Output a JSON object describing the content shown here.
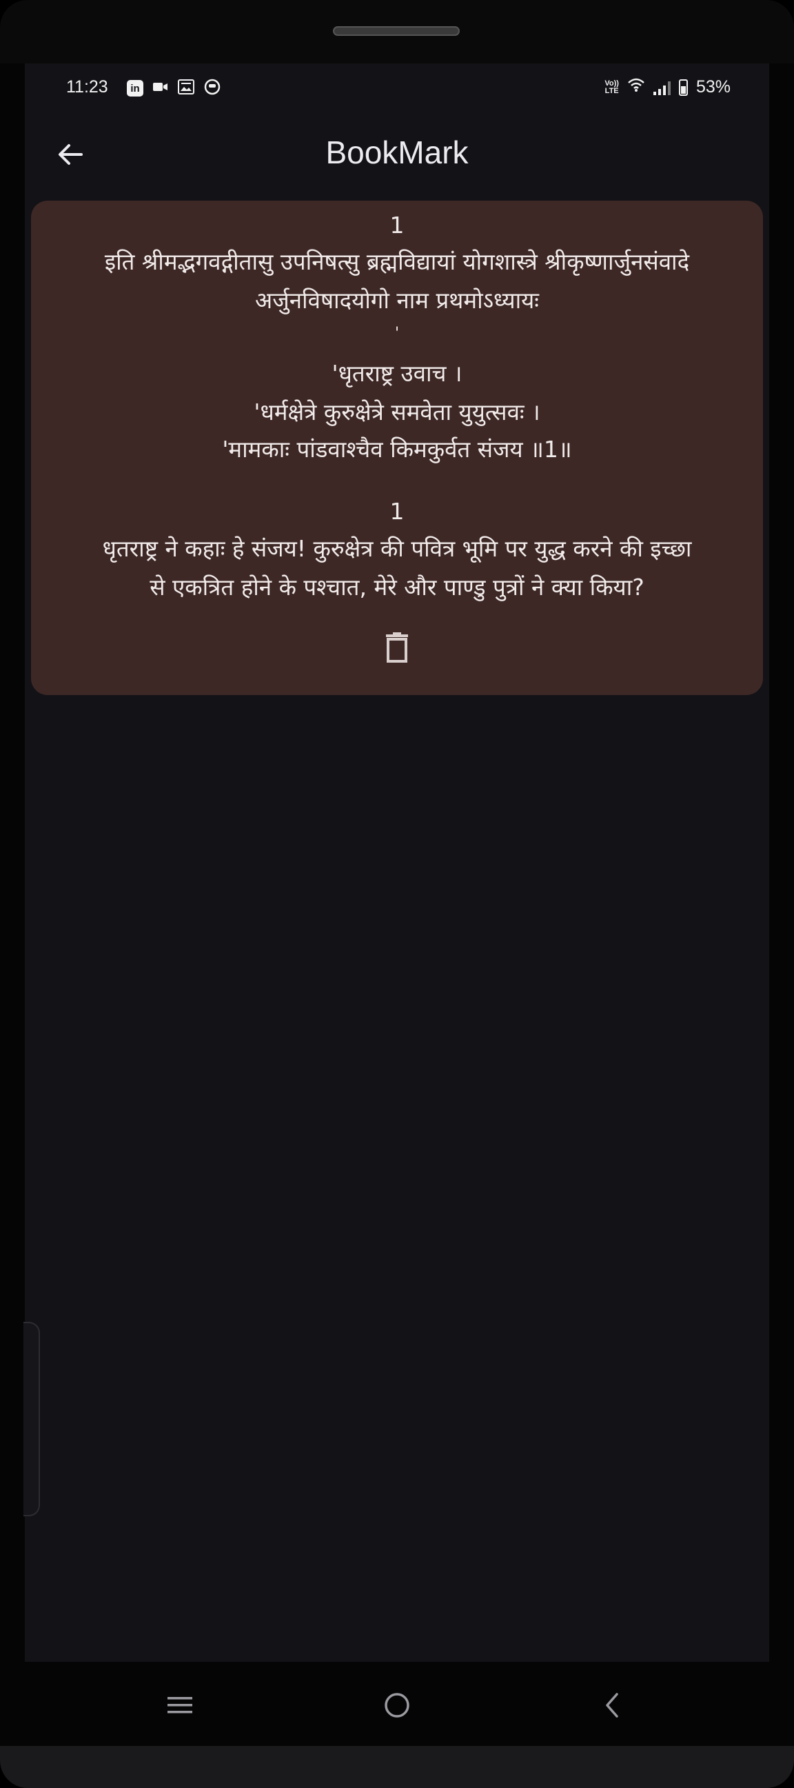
{
  "status_bar": {
    "time": "11:23",
    "left_icons": [
      "linkedin-icon",
      "video-icon",
      "gallery-icon",
      "notification-icon"
    ],
    "volte_line1": "Vo))",
    "volte_line2": "LTE",
    "battery_percent": "53%"
  },
  "app_bar": {
    "title": "BookMark",
    "back_icon": "arrow-left-icon"
  },
  "bookmarks": [
    {
      "verse_number": "1",
      "chapter_line1": "इति श्रीमद्भगवद्गीतासु उपनिषत्सु ब्रह्मविद्यायां योगशास्त्रे श्रीकृष्णार्जुनसंवादे",
      "chapter_line2": "अर्जुनविषादयोगो नाम प्रथमोऽध्यायः",
      "separator": "'",
      "shloka_line1": "'धृतराष्ट्र उवाच ।",
      "shloka_line2": "'धर्मक्षेत्रे कुरुक्षेत्रे समवेता युयुत्सवः ।",
      "shloka_line3": "'मामकाः पांडवाश्चैव किमकुर्वत संजय ॥1॥",
      "meaning_number": "1",
      "meaning_line1": "धृतराष्ट्र ने कहाः हे संजय! कुरुक्षेत्र की पवित्र भूमि पर युद्ध करने की इच्छा",
      "meaning_line2": "से एकत्रित होने के पश्चात, मेरे और पाण्डु पुत्रों ने क्या किया?",
      "delete_icon": "trash-icon"
    }
  ],
  "nav_bar": {
    "recents_icon": "menu-lines-icon",
    "home_icon": "home-circle-icon",
    "back_icon": "chevron-left-icon"
  },
  "colors": {
    "screen_background": "#131217",
    "card_background": "#3d2826",
    "text_primary": "#f1ebe9"
  }
}
